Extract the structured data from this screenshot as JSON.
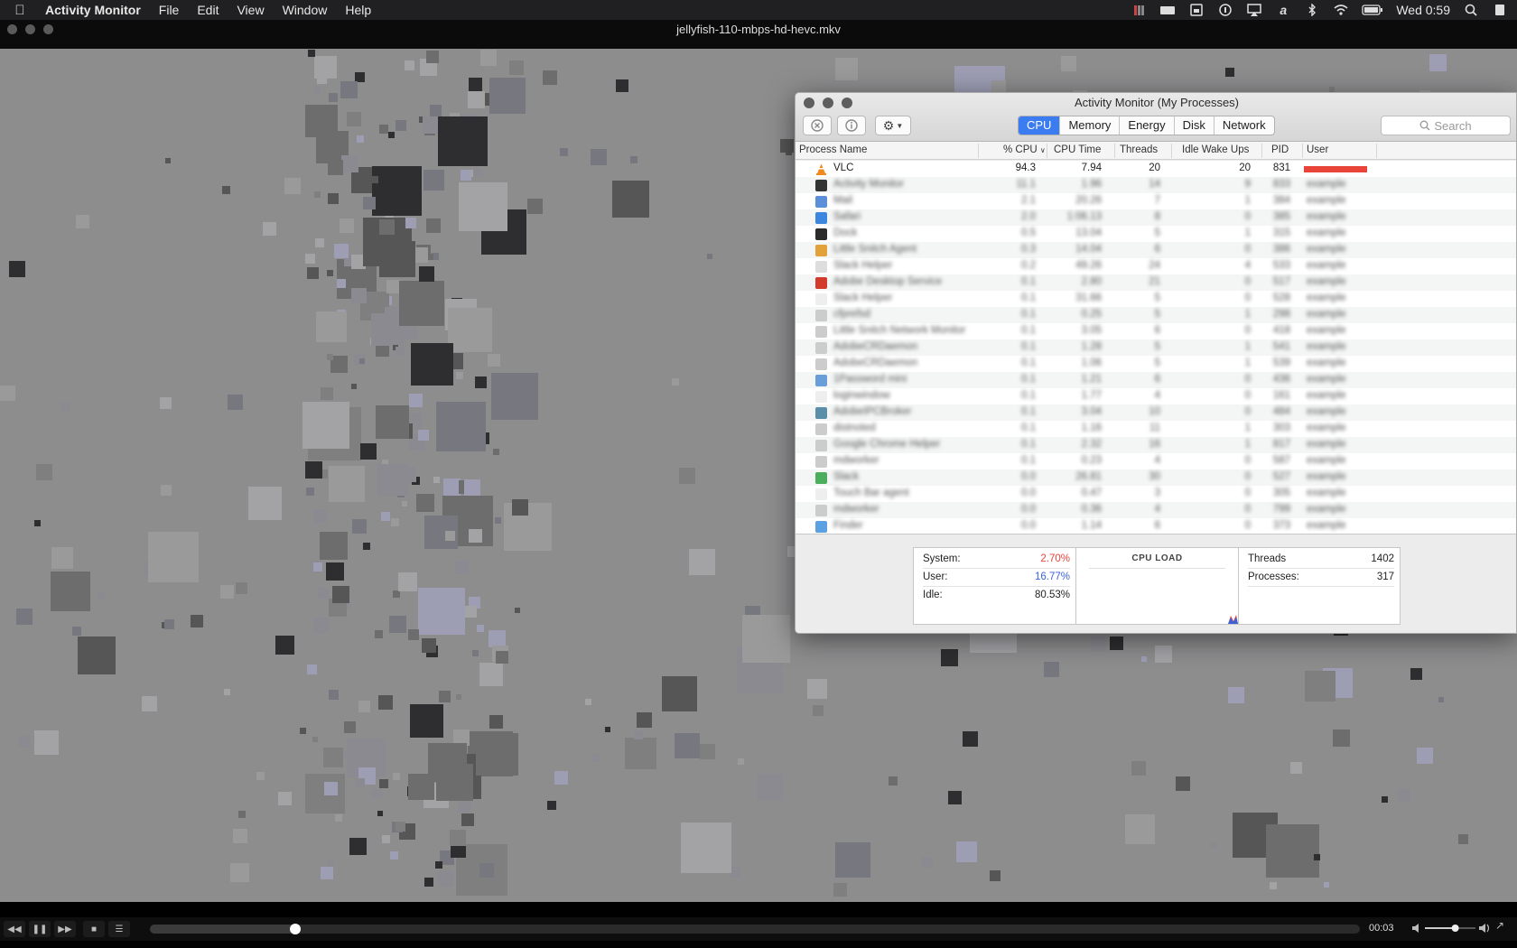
{
  "menubar": {
    "app_name": "Activity Monitor",
    "items": [
      "File",
      "Edit",
      "View",
      "Window",
      "Help"
    ],
    "clock": "Wed 0:59",
    "status_icons": [
      "bars-icon",
      "drive-icon",
      "calendar-icon",
      "info-circle-icon",
      "airplay-icon",
      "text-a-icon",
      "bluetooth-icon",
      "wifi-icon",
      "battery-icon",
      "search-icon",
      "list-icon"
    ]
  },
  "vlc": {
    "window_title": "jellyfish-110-mbps-hd-hevc.mkv",
    "timecode": "00:03",
    "progress": 0.12,
    "volume": 0.6
  },
  "activity_monitor": {
    "title": "Activity Monitor (My Processes)",
    "tabs": [
      "CPU",
      "Memory",
      "Energy",
      "Disk",
      "Network"
    ],
    "active_tab": "CPU",
    "search_placeholder": "Search",
    "columns": [
      "Process Name",
      "% CPU",
      "CPU Time",
      "Threads",
      "Idle Wake Ups",
      "PID",
      "User"
    ],
    "processes": [
      {
        "name": "VLC",
        "cpu": "94.3",
        "time": "7.94",
        "threads": "20",
        "wakeups": "20",
        "pid": "831",
        "user": ""
      },
      {
        "name": "Activity Monitor",
        "cpu": "11.1",
        "time": "1.96",
        "threads": "14",
        "wakeups": "9",
        "pid": "833",
        "user": "example"
      },
      {
        "name": "Mail",
        "cpu": "2.1",
        "time": "20.26",
        "threads": "7",
        "wakeups": "1",
        "pid": "384",
        "user": "example"
      },
      {
        "name": "Safari",
        "cpu": "2.0",
        "time": "1:06.13",
        "threads": "8",
        "wakeups": "0",
        "pid": "385",
        "user": "example"
      },
      {
        "name": "Dock",
        "cpu": "0.5",
        "time": "13.04",
        "threads": "5",
        "wakeups": "1",
        "pid": "315",
        "user": "example"
      },
      {
        "name": "Little Snitch Agent",
        "cpu": "0.3",
        "time": "14.04",
        "threads": "6",
        "wakeups": "0",
        "pid": "386",
        "user": "example"
      },
      {
        "name": "Slack Helper",
        "cpu": "0.2",
        "time": "49.26",
        "threads": "24",
        "wakeups": "4",
        "pid": "533",
        "user": "example"
      },
      {
        "name": "Adobe Desktop Service",
        "cpu": "0.1",
        "time": "2.80",
        "threads": "21",
        "wakeups": "0",
        "pid": "517",
        "user": "example"
      },
      {
        "name": "Slack Helper",
        "cpu": "0.1",
        "time": "31.66",
        "threads": "5",
        "wakeups": "0",
        "pid": "528",
        "user": "example"
      },
      {
        "name": "cfprefsd",
        "cpu": "0.1",
        "time": "0.25",
        "threads": "5",
        "wakeups": "1",
        "pid": "298",
        "user": "example"
      },
      {
        "name": "Little Snitch Network Monitor",
        "cpu": "0.1",
        "time": "3.05",
        "threads": "6",
        "wakeups": "0",
        "pid": "418",
        "user": "example"
      },
      {
        "name": "AdobeCRDaemon",
        "cpu": "0.1",
        "time": "1.28",
        "threads": "5",
        "wakeups": "1",
        "pid": "541",
        "user": "example"
      },
      {
        "name": "AdobeCRDaemon",
        "cpu": "0.1",
        "time": "1.06",
        "threads": "5",
        "wakeups": "1",
        "pid": "539",
        "user": "example"
      },
      {
        "name": "1Password mini",
        "cpu": "0.1",
        "time": "1.21",
        "threads": "6",
        "wakeups": "0",
        "pid": "436",
        "user": "example"
      },
      {
        "name": "loginwindow",
        "cpu": "0.1",
        "time": "1.77",
        "threads": "4",
        "wakeups": "0",
        "pid": "161",
        "user": "example"
      },
      {
        "name": "AdobeIPCBroker",
        "cpu": "0.1",
        "time": "3.04",
        "threads": "10",
        "wakeups": "0",
        "pid": "484",
        "user": "example"
      },
      {
        "name": "distnoted",
        "cpu": "0.1",
        "time": "1.16",
        "threads": "11",
        "wakeups": "1",
        "pid": "303",
        "user": "example"
      },
      {
        "name": "Google Chrome Helper",
        "cpu": "0.1",
        "time": "2.32",
        "threads": "16",
        "wakeups": "1",
        "pid": "817",
        "user": "example"
      },
      {
        "name": "mdworker",
        "cpu": "0.1",
        "time": "0.23",
        "threads": "4",
        "wakeups": "0",
        "pid": "587",
        "user": "example"
      },
      {
        "name": "Slack",
        "cpu": "0.0",
        "time": "26.81",
        "threads": "30",
        "wakeups": "0",
        "pid": "527",
        "user": "example"
      },
      {
        "name": "Touch Bar agent",
        "cpu": "0.0",
        "time": "0.47",
        "threads": "3",
        "wakeups": "0",
        "pid": "305",
        "user": "example"
      },
      {
        "name": "mdworker",
        "cpu": "0.0",
        "time": "0.36",
        "threads": "4",
        "wakeups": "0",
        "pid": "799",
        "user": "example"
      },
      {
        "name": "Finder",
        "cpu": "0.0",
        "time": "1.14",
        "threads": "6",
        "wakeups": "0",
        "pid": "373",
        "user": "example"
      }
    ],
    "summary": {
      "system_label": "System:",
      "system_value": "2.70%",
      "user_label": "User:",
      "user_value": "16.77%",
      "idle_label": "Idle:",
      "idle_value": "80.53%",
      "cpu_load_title": "CPU LOAD",
      "threads_label": "Threads",
      "threads_value": "1402",
      "processes_label": "Processes:",
      "processes_value": "317"
    },
    "colors": {
      "system": "#e8443a",
      "user": "#3a63d8",
      "accent": "#3b7cf1"
    }
  }
}
